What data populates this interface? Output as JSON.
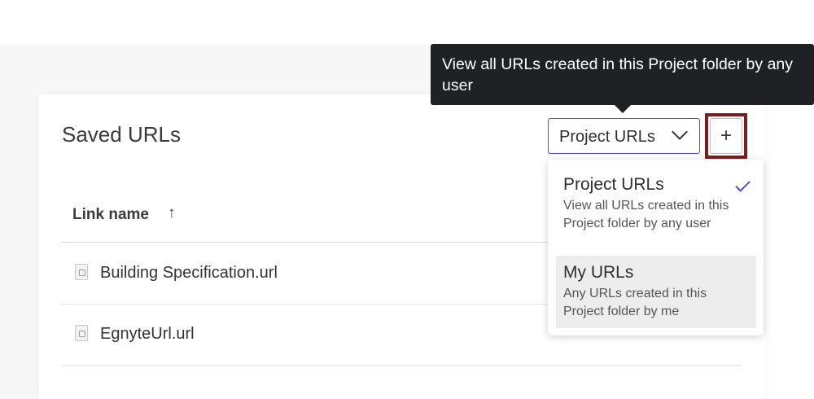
{
  "card": {
    "title": "Saved URLs"
  },
  "table": {
    "columns": [
      {
        "label": "Link name",
        "sort": "ascending",
        "sort_icon": "arrow-up-icon"
      }
    ],
    "rows": [
      {
        "name": "Building Specification.url",
        "icon": "url-file-icon"
      },
      {
        "name": "EgnyteUrl.url",
        "icon": "url-file-icon"
      }
    ]
  },
  "filter": {
    "selected": "Project URLs",
    "options": [
      {
        "title": "Project URLs",
        "description": "View all URLs created in this Project folder by any user",
        "selected": true
      },
      {
        "title": "My URLs",
        "description": "Any URLs created in this Project folder by me",
        "selected": false,
        "hovered": true
      }
    ]
  },
  "add_button": {
    "label": "+",
    "highlight_color": "#7c1c1c"
  },
  "tooltip": {
    "text": "View all URLs created in this Project folder by any user"
  },
  "colors": {
    "accent": "#5b4fc4",
    "tooltip_bg": "#202124"
  }
}
